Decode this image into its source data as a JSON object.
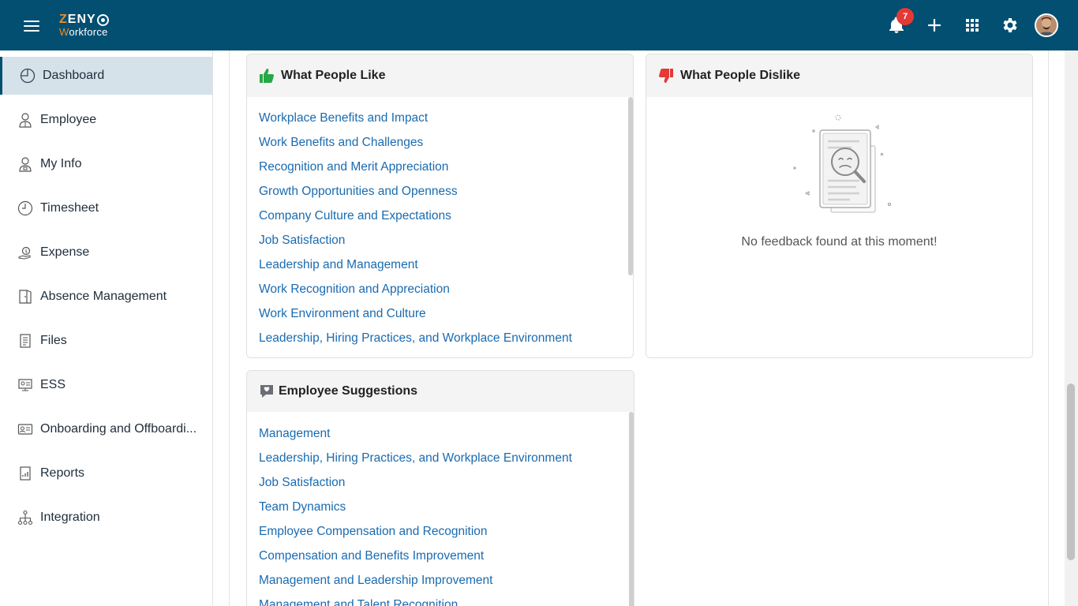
{
  "app": {
    "logo_top": "ZENY",
    "logo_bottom": "Workforce"
  },
  "header": {
    "notification_count": "7",
    "icons": [
      "hamburger-icon",
      "bell-icon",
      "plus-icon",
      "apps-grid-icon",
      "gear-icon",
      "avatar"
    ]
  },
  "sidebar": {
    "items": [
      {
        "label": "Dashboard",
        "icon": "dashboard-icon",
        "active": true
      },
      {
        "label": "Employee",
        "icon": "employee-icon"
      },
      {
        "label": "My Info",
        "icon": "my-info-icon"
      },
      {
        "label": "Timesheet",
        "icon": "clock-icon"
      },
      {
        "label": "Expense",
        "icon": "expense-icon"
      },
      {
        "label": "Absence Management",
        "icon": "door-icon"
      },
      {
        "label": "Files",
        "icon": "file-icon"
      },
      {
        "label": "ESS",
        "icon": "ess-icon"
      },
      {
        "label": "Onboarding and Offboardi...",
        "icon": "id-card-icon"
      },
      {
        "label": "Reports",
        "icon": "report-icon"
      },
      {
        "label": "Integration",
        "icon": "hierarchy-icon"
      }
    ]
  },
  "likes": {
    "title": "What People Like",
    "items": [
      "Workplace Benefits and Impact",
      "Work Benefits and Challenges",
      "Recognition and Merit Appreciation",
      "Growth Opportunities and Openness",
      "Company Culture and Expectations",
      "Job Satisfaction",
      "Leadership and Management",
      "Work Recognition and Appreciation",
      "Work Environment and Culture",
      "Leadership, Hiring Practices, and Workplace Environment"
    ]
  },
  "dislikes": {
    "title": "What People Dislike",
    "empty_text": "No feedback found at this moment!"
  },
  "suggestions": {
    "title": "Employee Suggestions",
    "items": [
      "Management",
      "Leadership, Hiring Practices, and Workplace Environment",
      "Job Satisfaction",
      "Team Dynamics",
      "Employee Compensation and Recognition",
      "Compensation and Benefits Improvement",
      "Management and Leadership Improvement",
      "Management and Talent Recognition"
    ]
  },
  "colors": {
    "header_bg": "#024f72",
    "accent_orange": "#f08a24",
    "link": "#1a6bb0",
    "like_green": "#27a745",
    "dislike_red": "#e53935",
    "badge_red": "#e53935"
  }
}
